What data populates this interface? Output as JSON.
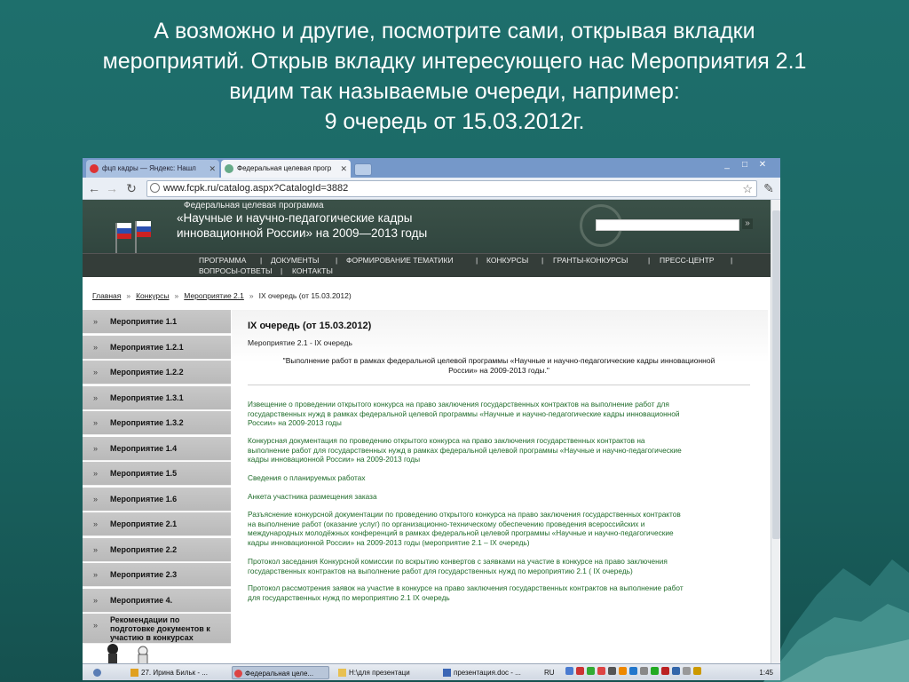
{
  "slide": {
    "title_lines": [
      "А возможно и другие, посмотрите сами, открывая вкладки",
      "мероприятий. Открыв вкладку  интересующего нас Мероприятия 2.1",
      "видим так называемые очереди, например:",
      "9 очередь от 15.03.2012г."
    ]
  },
  "browser": {
    "tabs": [
      {
        "label": "фцп кадры — Яндекс: Нашл"
      },
      {
        "label": "Федеральная целевая прогр"
      }
    ],
    "url": "www.fcpk.ru/catalog.aspx?CatalogId=3882",
    "window_buttons": [
      "_",
      "□",
      "✕"
    ]
  },
  "site": {
    "program_label": "Федеральная целевая программа",
    "program_name_line1": "«Научные и научно-педагогические кадры",
    "program_name_line2": "инновационной России» на 2009—2013 годы",
    "nav_row1": [
      "ПРОГРАММА",
      "|",
      "ДОКУМЕНТЫ",
      "|",
      "ФОРМИРОВАНИЕ ТЕМАТИКИ",
      "|",
      "КОНКУРСЫ",
      "|",
      "ГРАНТЫ-КОНКУРСЫ",
      "|",
      "ПРЕСС-ЦЕНТР",
      "|"
    ],
    "nav_row2": [
      "ВОПРОСЫ-ОТВЕТЫ",
      "|",
      "КОНТАКТЫ"
    ],
    "breadcrumb": [
      "Главная",
      "Конкурсы",
      "Мероприятие 2.1",
      "IX очередь (от 15.03.2012)"
    ],
    "breadcrumb_sep": "»",
    "sidebar": [
      "Мероприятие 1.1",
      "Мероприятие 1.2.1",
      "Мероприятие 1.2.2",
      "Мероприятие 1.3.1",
      "Мероприятие 1.3.2",
      "Мероприятие 1.4",
      "Мероприятие 1.5",
      "Мероприятие 1.6",
      "Мероприятие 2.1",
      "Мероприятие 2.2",
      "Мероприятие 2.3",
      "Мероприятие 4."
    ],
    "sidebar_last_lines": [
      "Рекомендации по",
      "подготовке документов к",
      "участию в конкурсах"
    ],
    "sidebar_arrow": "»",
    "content": {
      "title": "IX очередь (от 15.03.2012)",
      "subtitle": "Мероприятие 2.1 - IX очередь",
      "quote_line1": "\"Выполнение работ в рамках федеральной целевой программы «Научные и научно-педагогические кадры инновационной",
      "quote_line2": "России» на 2009-2013 годы.\"",
      "links": [
        [
          "Извещение о проведении открытого конкурса на право заключения государственных контрактов на выполнение работ для",
          "государственных нужд в рамках федеральной целевой программы «Научные и научно-педагогические кадры инновационной",
          "России» на 2009-2013 годы"
        ],
        [
          "Конкурсная документация по проведению открытого конкурса на право заключения государственных контрактов на",
          "выполнение работ для государственных нужд в рамках федеральной целевой программы «Научные и научно-педагогические",
          "кадры инновационной России» на 2009-2013 годы"
        ],
        [
          "Сведения о планируемых работах"
        ],
        [
          "Анкета участника размещения заказа"
        ],
        [
          "Разъяснение конкурсной документации по проведению открытого конкурса на право заключения государственных контрактов",
          "на выполнение работ (оказание услуг) по организационно-техническому обеспечению проведения всероссийских и",
          "международных молодёжных конференций в рамках федеральной целевой программы «Научные и научно-педагогические",
          "кадры инновационной России» на 2009-2013 годы (мероприятие 2.1 – IX очередь)"
        ],
        [
          "Протокол заседания Конкурсной комиссии по вскрытию конвертов с заявками на участие в конкурсе на право заключения",
          "государственных контрактов на выполнение работ для государственных нужд по мероприятию 2.1 ( IX очередь)"
        ],
        [
          "Протокол рассмотрения заявок на участие в конкурсе на право заключения государственных контрактов на выполнение работ",
          "для государственных нужд по мероприятию 2.1 IX очередь"
        ]
      ]
    }
  },
  "taskbar": {
    "items": [
      "27. Ирина Бильк - ...",
      "Федеральная целе...",
      "H:\\для презентаци",
      "презентация.doc - ..."
    ],
    "lang": "RU",
    "clock": "1:45"
  },
  "colors": {
    "slide_bg": "#1e6f6c",
    "link_green": "#1f6b2a",
    "banner": "#3b5148"
  }
}
